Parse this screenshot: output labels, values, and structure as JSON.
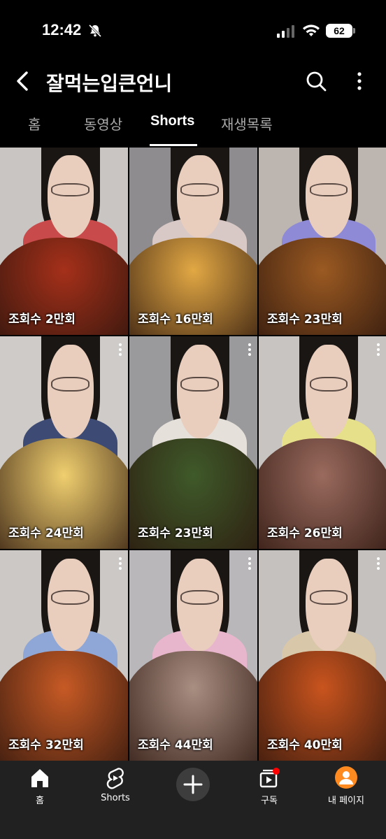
{
  "status_bar": {
    "time": "12:42",
    "battery": "62"
  },
  "header": {
    "channel_name": "잘먹는입큰언니"
  },
  "tabs": [
    {
      "label": "홈"
    },
    {
      "label": "동영상"
    },
    {
      "label": "Shorts"
    },
    {
      "label": "재생목록"
    }
  ],
  "shorts": [
    {
      "views": "조회수 2만회",
      "food_color": "#a5301a",
      "wall_color": "#c9c5c2",
      "shirt_color": "#c84a4a"
    },
    {
      "views": "조회수 16만회",
      "food_color": "#e2a844",
      "wall_color": "#8e8c8f",
      "shirt_color": "#d9c9c6"
    },
    {
      "views": "조회수 23만회",
      "food_color": "#9b5a22",
      "wall_color": "#bdb6b0",
      "shirt_color": "#8f8ad6"
    },
    {
      "views": "조회수 24만회",
      "food_color": "#f0cf6f",
      "wall_color": "#cfcbc8",
      "shirt_color": "#3d4a73"
    },
    {
      "views": "조회수 23만회",
      "food_color": "#3f5a2a",
      "wall_color": "#9a9a9c",
      "shirt_color": "#e5e0da"
    },
    {
      "views": "조회수 26만회",
      "food_color": "#9a6a5e",
      "wall_color": "#c8c4c1",
      "shirt_color": "#e6e08a"
    },
    {
      "views": "조회수 32만회",
      "food_color": "#c75a25",
      "wall_color": "#cbc8c5",
      "shirt_color": "#8fa7d6"
    },
    {
      "views": "조회수 44만회",
      "food_color": "#a98e82",
      "wall_color": "#b9b7ba",
      "shirt_color": "#e8b6cc"
    },
    {
      "views": "조회수 40만회",
      "food_color": "#c9541e",
      "wall_color": "#c5c1bf",
      "shirt_color": "#d8c7a8"
    }
  ],
  "bottom_nav": {
    "home": "홈",
    "shorts": "Shorts",
    "subscriptions": "구독",
    "my_page": "내 페이지"
  },
  "colors": {
    "active_tab": "#ffffff",
    "inactive_tab": "#aaaaaa",
    "avatar": "#ff8a1f",
    "notification_dot": "#ff0000"
  }
}
